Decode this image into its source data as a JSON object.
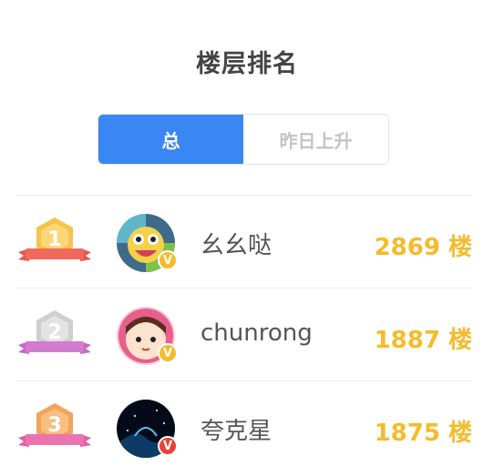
{
  "header": {
    "title": "楼层排名"
  },
  "tabs": [
    {
      "label": "总",
      "active": true
    },
    {
      "label": "昨日上升",
      "active": false
    }
  ],
  "colors": {
    "accent": "#3a86f2",
    "floor_count": "#f6bb2c",
    "rank_gold": "#f7c34a",
    "rank_silver": "#cfcfcf",
    "rank_bronze": "#f2a45a"
  },
  "ranking": [
    {
      "rank": "1",
      "badge_text": "1",
      "name": "幺幺哒",
      "floors": "2869 楼",
      "verified_color": "#f6bb2c"
    },
    {
      "rank": "2",
      "badge_text": "2",
      "name": "chunrong",
      "floors": "1887 楼",
      "verified_color": "#f6bb2c"
    },
    {
      "rank": "3",
      "badge_text": "3",
      "name": "夸克星",
      "floors": "1875 楼",
      "verified_color": "#e8423a"
    }
  ]
}
